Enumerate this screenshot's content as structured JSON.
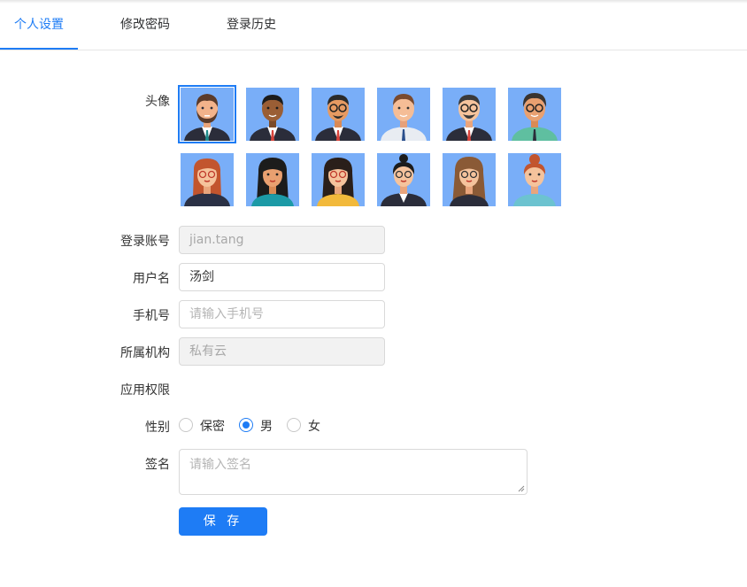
{
  "tabs": [
    {
      "label": "个人设置",
      "active": true
    },
    {
      "label": "修改密码",
      "active": false
    },
    {
      "label": "登录历史",
      "active": false
    }
  ],
  "colors": {
    "accent": "#1e7cf5",
    "avatar_bg": "#79aef8"
  },
  "form": {
    "avatar_label": "头像",
    "avatars": {
      "selected_index": 0,
      "male": [
        "avatar-man-beard",
        "avatar-man-dark-skin",
        "avatar-man-glasses-goatee",
        "avatar-man-white-shirt",
        "avatar-man-glasses-beard",
        "avatar-man-glasses-green-shirt"
      ],
      "female": [
        "avatar-woman-redhead-glasses",
        "avatar-woman-black-hair",
        "avatar-woman-glasses-yellow",
        "avatar-woman-bun-glasses",
        "avatar-woman-long-brown-hair",
        "avatar-woman-red-bun"
      ]
    },
    "account_label": "登录账号",
    "account_value": "jian.tang",
    "username_label": "用户名",
    "username_value": "汤剑",
    "phone_label": "手机号",
    "phone_placeholder": "请输入手机号",
    "org_label": "所属机构",
    "org_value": "私有云",
    "permission_label": "应用权限",
    "gender_label": "性别",
    "gender_options": [
      {
        "label": "保密",
        "checked": false
      },
      {
        "label": "男",
        "checked": true
      },
      {
        "label": "女",
        "checked": false
      }
    ],
    "signature_label": "签名",
    "signature_placeholder": "请输入签名",
    "save_label": "保 存"
  }
}
